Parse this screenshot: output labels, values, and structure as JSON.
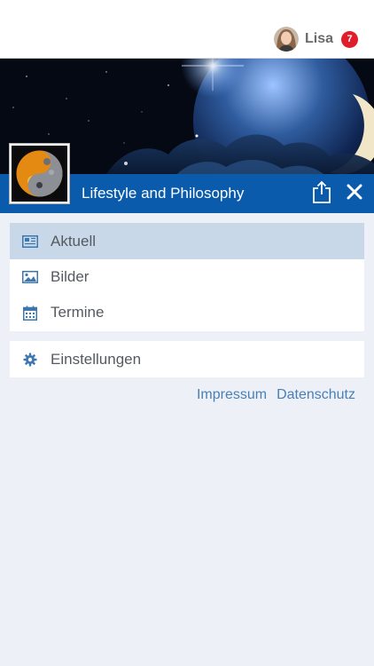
{
  "header": {
    "user_name": "Lisa",
    "notification_count": "7"
  },
  "group": {
    "title": "Lifestyle and Philosophy"
  },
  "menu": {
    "items": [
      {
        "label": "Aktuell",
        "icon": "newspaper-icon",
        "active": true
      },
      {
        "label": "Bilder",
        "icon": "image-icon",
        "active": false
      },
      {
        "label": "Termine",
        "icon": "calendar-icon",
        "active": false
      }
    ],
    "settings": {
      "label": "Einstellungen",
      "icon": "gear-icon"
    }
  },
  "footer": {
    "impressum": "Impressum",
    "datenschutz": "Datenschutz"
  },
  "colors": {
    "brand_blue": "#0a5bab",
    "active_item": "#c9d8e9",
    "badge_red": "#e01e2a",
    "link_blue": "#4a7fb5",
    "page_bg": "#edf1f7"
  }
}
